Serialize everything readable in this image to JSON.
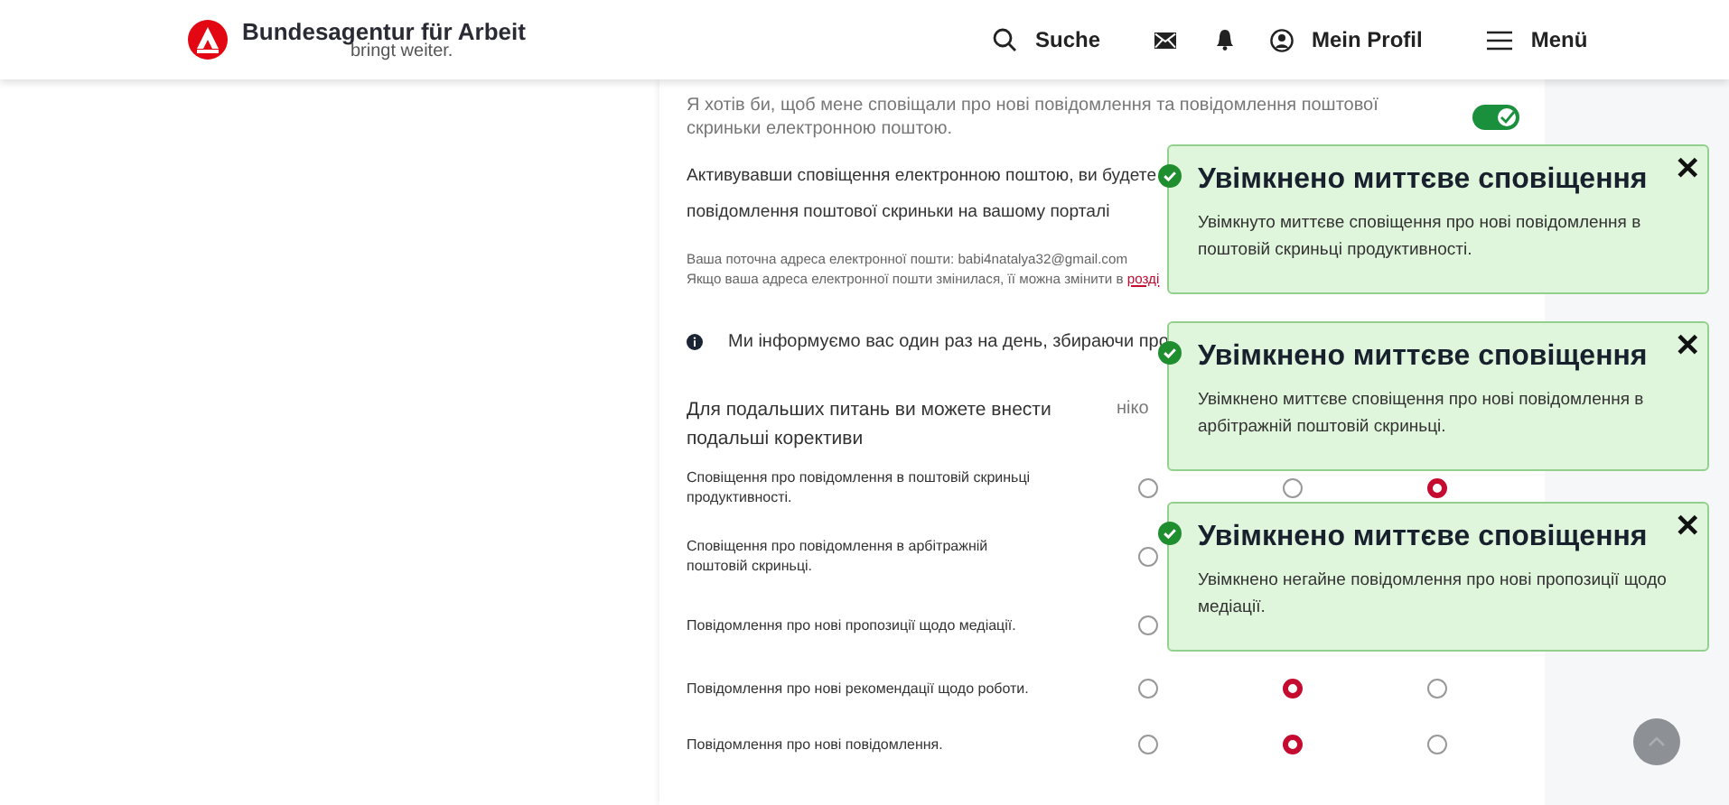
{
  "header": {
    "logo_title": "Bundesagentur für Arbeit",
    "logo_subtitle": "bringt weiter.",
    "nav": [
      {
        "kind": "search",
        "label": "Suche"
      },
      {
        "kind": "mail"
      },
      {
        "kind": "bell"
      },
      {
        "kind": "profile",
        "label": "Mein Profil"
      },
      {
        "kind": "menu",
        "label": "Menü"
      }
    ]
  },
  "email_setting": {
    "label": "Я хотів би, щоб мене сповіщали про нові повідомлення та повідомлення поштової скриньки електронною поштою.",
    "on": true
  },
  "activation_lines": [
    "Активувавши сповіщення електронною поштою, ви будете",
    "повідомлення поштової скриньки на вашому порталі"
  ],
  "current_email": "Ваша поточна адреса електронної пошти: babi4natalya32@gmail.com",
  "change_note": {
    "text": "Якщо ваша адреса електронної пошти змінилася, її можна змінити в ",
    "link": "розді"
  },
  "info": "Ми інформуємо вас один раз на день, збираючи про",
  "settings": {
    "intro": "Для подальших питань ви можете внести подальші корективи",
    "column_1": "ніко",
    "rows": [
      {
        "label": "Сповіщення про повідомлення в поштовій скриньці продуктивності.",
        "options": [
          {
            "selected": false
          },
          {
            "selected": false
          },
          {
            "selected": true
          }
        ]
      },
      {
        "label": "Сповіщення про повідомлення в арбітражній поштовій скриньці.",
        "options": [
          {
            "selected": false
          }
        ]
      },
      {
        "label": "Повідомлення про нові пропозиції щодо медіації.",
        "options": [
          {
            "selected": false
          }
        ]
      },
      {
        "label": "Повідомлення про нові рекомендації щодо роботи.",
        "options": [
          {
            "selected": false
          },
          {
            "selected": true
          },
          {
            "selected": false
          }
        ]
      },
      {
        "label": "Повідомлення про нові повідомлення.",
        "options": [
          {
            "selected": false
          },
          {
            "selected": true
          },
          {
            "selected": false
          }
        ]
      }
    ]
  },
  "toasts": [
    {
      "title": "Увімкнено миттєве сповіщення",
      "message": "Увімкнуто миттєве сповіщення про нові повідомлення в поштовій скриньці продуктивності.",
      "close": "✕"
    },
    {
      "title": "Увімкнено миттєве сповіщення",
      "message": "Увімкнено миттєве сповіщення про нові повідомлення в арбітражній поштовій скриньці.",
      "close": "✕"
    },
    {
      "title": "Увімкнено миттєве сповіщення",
      "message": "Увімкнено негайне повідомлення про нові пропозиції щодо медіації.",
      "close": "✕"
    }
  ]
}
